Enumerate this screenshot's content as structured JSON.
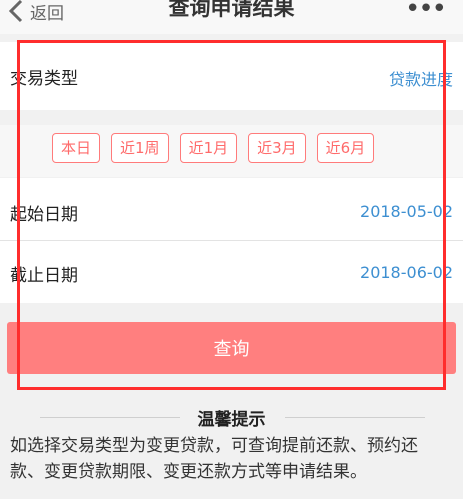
{
  "nav": {
    "back_label": "返回",
    "title": "查询申请结果",
    "more_label": "•••"
  },
  "form": {
    "transaction_type": {
      "label": "交易类型",
      "value": "贷款进度"
    },
    "quick_ranges": [
      "本日",
      "近1周",
      "近1月",
      "近3月",
      "近6月"
    ],
    "start_date": {
      "label": "起始日期",
      "value": "2018-05-02"
    },
    "end_date": {
      "label": "截止日期",
      "value": "2018-06-02"
    },
    "query_label": "查询"
  },
  "tips": {
    "title": "温馨提示",
    "body": "如选择交易类型为变更贷款，可查询提前还款、预约还款、变更贷款期限、变更还款方式等申请结果。"
  },
  "colors": {
    "accent_red": "#ff7f7f",
    "link_blue": "#3d8fd1",
    "highlight": "#ff2d2d"
  }
}
